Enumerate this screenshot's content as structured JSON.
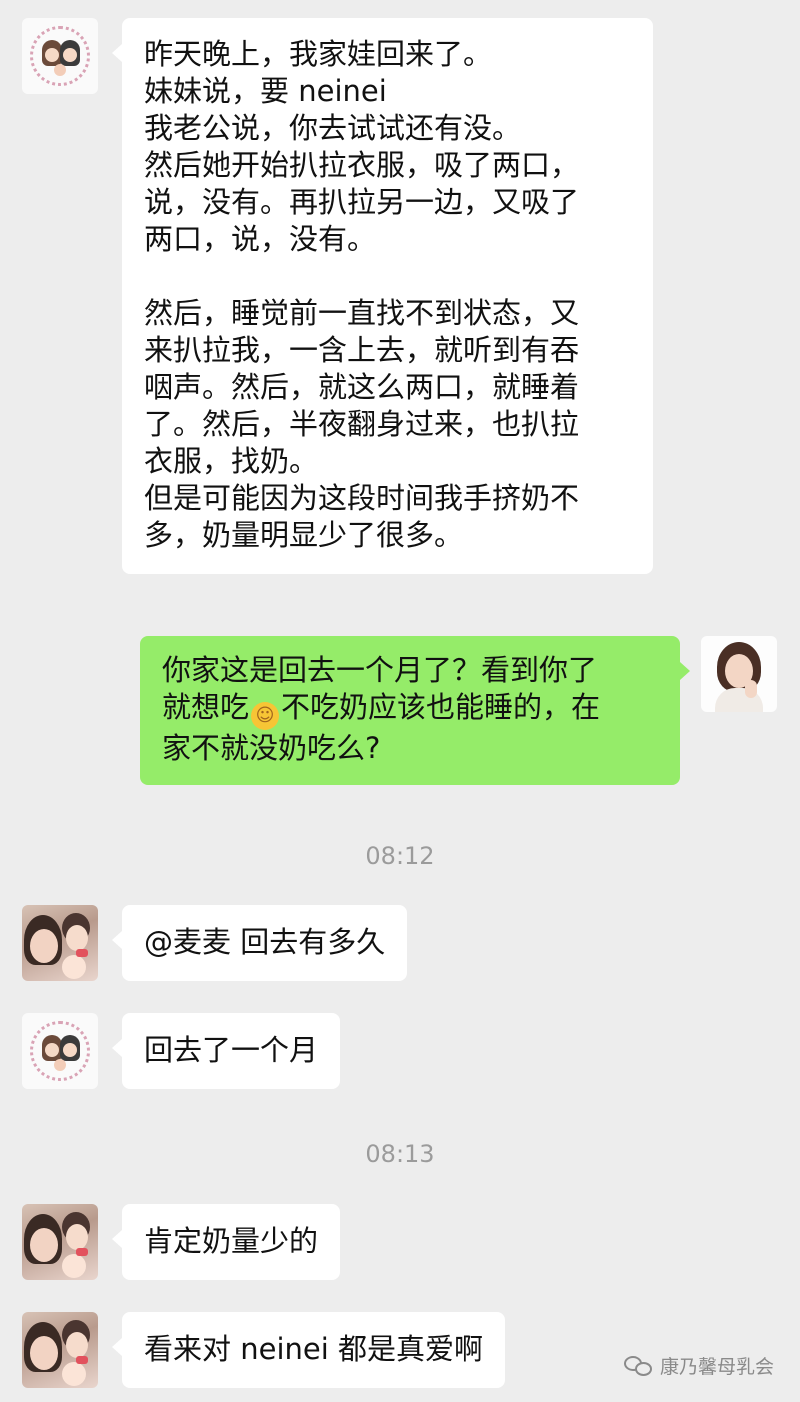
{
  "messages": [
    {
      "lines": [
        "昨天晚上，我家娃回来了。",
        "妹妹说，要 neinei",
        "我老公说，你去试试还有没。",
        "然后她开始扒拉衣服，吸了两口，",
        "说，没有。再扒拉另一边，又吸了",
        "两口，说，没有。"
      ],
      "lines2": [
        "然后，睡觉前一直找不到状态，又",
        "来扒拉我，一含上去，就听到有吞",
        "咽声。然后，就这么两口，就睡着",
        "了。然后，半夜翻身过来，也扒拉",
        "衣服，找奶。",
        "但是可能因为这段时间我手挤奶不",
        "多，奶量明显少了很多。"
      ]
    },
    {
      "line1": "你家这是回去一个月了？看到你了",
      "line2_a": "就想吃",
      "line2_b": "不吃奶应该也能睡的，在",
      "line3": "家不就没奶吃么?"
    },
    {
      "text": "@麦麦 回去有多久"
    },
    {
      "text": "回去了一个月"
    },
    {
      "text": "肯定奶量少的"
    },
    {
      "text": "看来对 neinei 都是真爱啊"
    }
  ],
  "timestamps": [
    "08:12",
    "08:13"
  ],
  "emoji": {
    "name": "hug-emoji",
    "glyph": "☺"
  },
  "watermark": "康乃馨母乳会",
  "colors": {
    "background": "#ededed",
    "left_bubble": "#ffffff",
    "right_bubble": "#95ec69",
    "timestamp": "#9b9b9b"
  }
}
